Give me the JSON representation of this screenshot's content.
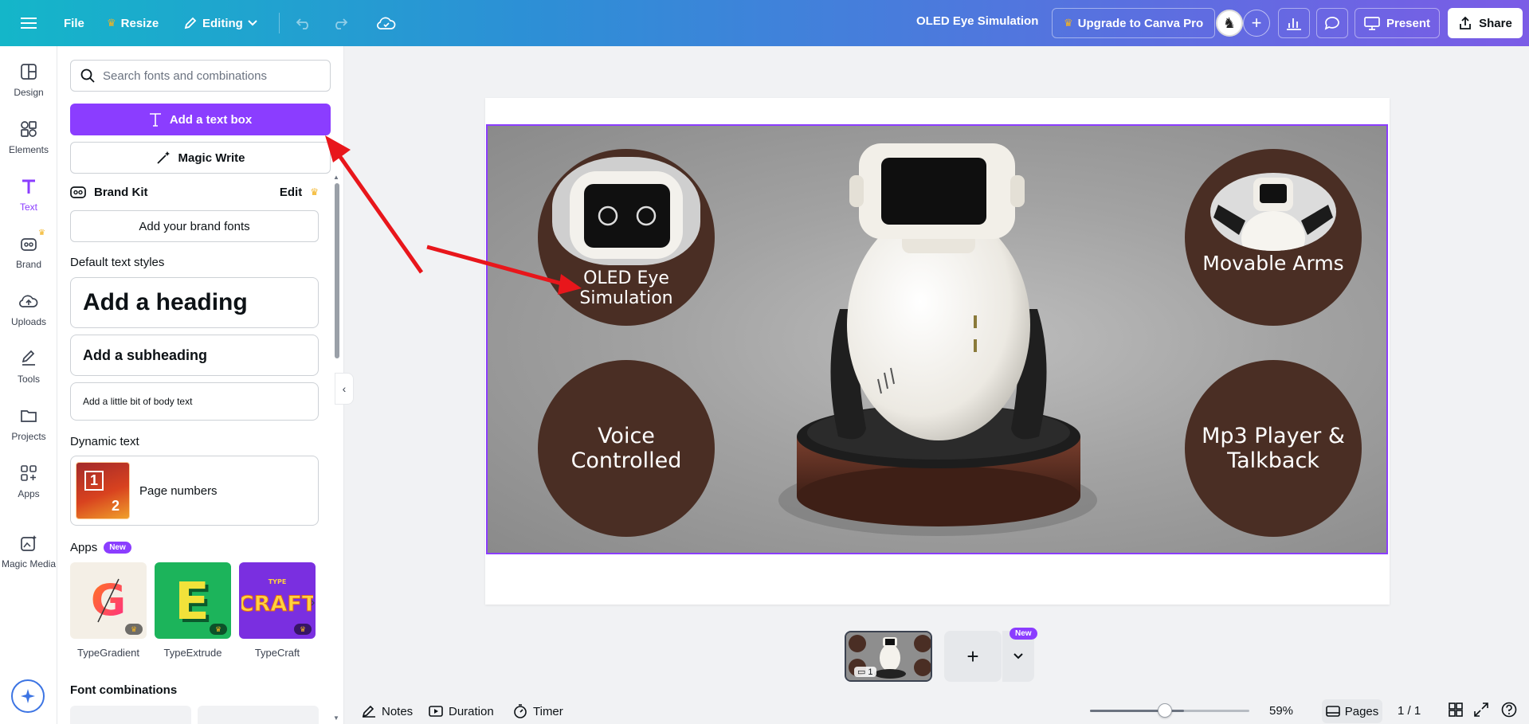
{
  "topbar": {
    "file": "File",
    "resize": "Resize",
    "editing": "Editing",
    "doc_title": "OLED Eye Simulation",
    "upgrade": "Upgrade to Canva Pro",
    "present": "Present",
    "share": "Share"
  },
  "rail": [
    {
      "label": "Design",
      "icon": "layout-icon"
    },
    {
      "label": "Elements",
      "icon": "shapes-icon"
    },
    {
      "label": "Text",
      "icon": "text-icon"
    },
    {
      "label": "Brand",
      "icon": "brand-icon"
    },
    {
      "label": "Uploads",
      "icon": "cloud-upload-icon"
    },
    {
      "label": "Tools",
      "icon": "pen-icon"
    },
    {
      "label": "Projects",
      "icon": "folder-icon"
    },
    {
      "label": "Apps",
      "icon": "apps-icon"
    },
    {
      "label": "Magic Media",
      "icon": "magic-media-icon"
    }
  ],
  "panel": {
    "search_placeholder": "Search fonts and combinations",
    "add_text_box": "Add a text box",
    "magic_write": "Magic Write",
    "brand_kit": "Brand Kit",
    "brand_edit": "Edit",
    "add_brand_fonts": "Add your brand fonts",
    "default_styles_title": "Default text styles",
    "heading": "Add a heading",
    "subheading": "Add a subheading",
    "body": "Add a little bit of body text",
    "dynamic_title": "Dynamic text",
    "page_numbers": "Page numbers",
    "pn_digit_1": "1",
    "pn_digit_2": "2",
    "apps_title": "Apps",
    "apps_badge": "New",
    "apps": [
      {
        "label": "TypeGradient",
        "glyph": "G"
      },
      {
        "label": "TypeExtrude",
        "glyph": "E"
      },
      {
        "label": "TypeCraft",
        "glyph": "CRAFT",
        "sub": "TYPE"
      }
    ],
    "font_combinations": "Font combinations"
  },
  "canvas": {
    "circles": [
      {
        "text": "OLED Eye Simulation"
      },
      {
        "text": "Movable Arms"
      },
      {
        "text": "Voice Controlled"
      },
      {
        "text": "Mp3 Player & Talkback"
      }
    ]
  },
  "pages": {
    "thumb_number": "1",
    "new_badge": "New"
  },
  "bottombar": {
    "notes": "Notes",
    "duration": "Duration",
    "timer": "Timer",
    "zoom": "59%",
    "zoom_fraction": 0.59,
    "pages": "Pages",
    "page_count": "1 / 1"
  },
  "colors": {
    "accent": "#8b3dff",
    "circle_fill": "#4a2e24",
    "arrow": "#e8161b"
  }
}
